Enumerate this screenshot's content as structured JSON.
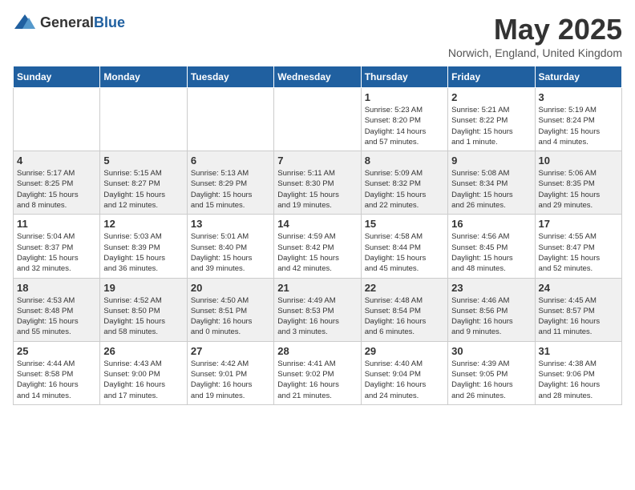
{
  "header": {
    "logo_general": "General",
    "logo_blue": "Blue",
    "month_year": "May 2025",
    "location": "Norwich, England, United Kingdom"
  },
  "weekdays": [
    "Sunday",
    "Monday",
    "Tuesday",
    "Wednesday",
    "Thursday",
    "Friday",
    "Saturday"
  ],
  "weeks": [
    [
      {
        "day": "",
        "info": ""
      },
      {
        "day": "",
        "info": ""
      },
      {
        "day": "",
        "info": ""
      },
      {
        "day": "",
        "info": ""
      },
      {
        "day": "1",
        "info": "Sunrise: 5:23 AM\nSunset: 8:20 PM\nDaylight: 14 hours\nand 57 minutes."
      },
      {
        "day": "2",
        "info": "Sunrise: 5:21 AM\nSunset: 8:22 PM\nDaylight: 15 hours\nand 1 minute."
      },
      {
        "day": "3",
        "info": "Sunrise: 5:19 AM\nSunset: 8:24 PM\nDaylight: 15 hours\nand 4 minutes."
      }
    ],
    [
      {
        "day": "4",
        "info": "Sunrise: 5:17 AM\nSunset: 8:25 PM\nDaylight: 15 hours\nand 8 minutes."
      },
      {
        "day": "5",
        "info": "Sunrise: 5:15 AM\nSunset: 8:27 PM\nDaylight: 15 hours\nand 12 minutes."
      },
      {
        "day": "6",
        "info": "Sunrise: 5:13 AM\nSunset: 8:29 PM\nDaylight: 15 hours\nand 15 minutes."
      },
      {
        "day": "7",
        "info": "Sunrise: 5:11 AM\nSunset: 8:30 PM\nDaylight: 15 hours\nand 19 minutes."
      },
      {
        "day": "8",
        "info": "Sunrise: 5:09 AM\nSunset: 8:32 PM\nDaylight: 15 hours\nand 22 minutes."
      },
      {
        "day": "9",
        "info": "Sunrise: 5:08 AM\nSunset: 8:34 PM\nDaylight: 15 hours\nand 26 minutes."
      },
      {
        "day": "10",
        "info": "Sunrise: 5:06 AM\nSunset: 8:35 PM\nDaylight: 15 hours\nand 29 minutes."
      }
    ],
    [
      {
        "day": "11",
        "info": "Sunrise: 5:04 AM\nSunset: 8:37 PM\nDaylight: 15 hours\nand 32 minutes."
      },
      {
        "day": "12",
        "info": "Sunrise: 5:03 AM\nSunset: 8:39 PM\nDaylight: 15 hours\nand 36 minutes."
      },
      {
        "day": "13",
        "info": "Sunrise: 5:01 AM\nSunset: 8:40 PM\nDaylight: 15 hours\nand 39 minutes."
      },
      {
        "day": "14",
        "info": "Sunrise: 4:59 AM\nSunset: 8:42 PM\nDaylight: 15 hours\nand 42 minutes."
      },
      {
        "day": "15",
        "info": "Sunrise: 4:58 AM\nSunset: 8:44 PM\nDaylight: 15 hours\nand 45 minutes."
      },
      {
        "day": "16",
        "info": "Sunrise: 4:56 AM\nSunset: 8:45 PM\nDaylight: 15 hours\nand 48 minutes."
      },
      {
        "day": "17",
        "info": "Sunrise: 4:55 AM\nSunset: 8:47 PM\nDaylight: 15 hours\nand 52 minutes."
      }
    ],
    [
      {
        "day": "18",
        "info": "Sunrise: 4:53 AM\nSunset: 8:48 PM\nDaylight: 15 hours\nand 55 minutes."
      },
      {
        "day": "19",
        "info": "Sunrise: 4:52 AM\nSunset: 8:50 PM\nDaylight: 15 hours\nand 58 minutes."
      },
      {
        "day": "20",
        "info": "Sunrise: 4:50 AM\nSunset: 8:51 PM\nDaylight: 16 hours\nand 0 minutes."
      },
      {
        "day": "21",
        "info": "Sunrise: 4:49 AM\nSunset: 8:53 PM\nDaylight: 16 hours\nand 3 minutes."
      },
      {
        "day": "22",
        "info": "Sunrise: 4:48 AM\nSunset: 8:54 PM\nDaylight: 16 hours\nand 6 minutes."
      },
      {
        "day": "23",
        "info": "Sunrise: 4:46 AM\nSunset: 8:56 PM\nDaylight: 16 hours\nand 9 minutes."
      },
      {
        "day": "24",
        "info": "Sunrise: 4:45 AM\nSunset: 8:57 PM\nDaylight: 16 hours\nand 11 minutes."
      }
    ],
    [
      {
        "day": "25",
        "info": "Sunrise: 4:44 AM\nSunset: 8:58 PM\nDaylight: 16 hours\nand 14 minutes."
      },
      {
        "day": "26",
        "info": "Sunrise: 4:43 AM\nSunset: 9:00 PM\nDaylight: 16 hours\nand 17 minutes."
      },
      {
        "day": "27",
        "info": "Sunrise: 4:42 AM\nSunset: 9:01 PM\nDaylight: 16 hours\nand 19 minutes."
      },
      {
        "day": "28",
        "info": "Sunrise: 4:41 AM\nSunset: 9:02 PM\nDaylight: 16 hours\nand 21 minutes."
      },
      {
        "day": "29",
        "info": "Sunrise: 4:40 AM\nSunset: 9:04 PM\nDaylight: 16 hours\nand 24 minutes."
      },
      {
        "day": "30",
        "info": "Sunrise: 4:39 AM\nSunset: 9:05 PM\nDaylight: 16 hours\nand 26 minutes."
      },
      {
        "day": "31",
        "info": "Sunrise: 4:38 AM\nSunset: 9:06 PM\nDaylight: 16 hours\nand 28 minutes."
      }
    ]
  ]
}
